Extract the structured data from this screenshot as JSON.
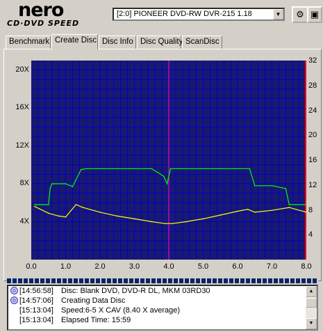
{
  "logo": {
    "brand": "nero",
    "product": "CD·DVD SPEED"
  },
  "drive": {
    "selected": "[2:0]  PIONEER DVD-RW  DVR-215 1.18"
  },
  "toolbar": {
    "icons": [
      "drive-settings-icon",
      "save-icon"
    ]
  },
  "tabs": [
    "Benchmark",
    "Create Disc",
    "Disc Info",
    "Disc Quality",
    "ScanDisc"
  ],
  "active_tab": "Create Disc",
  "colors": {
    "plot_bg": "#191970",
    "grid": "#0000c8",
    "write_speed": "#00ff00",
    "rpm": "#ffff00",
    "marker": "#ff00ff",
    "right_edge": "#ff0000"
  },
  "chart_data": {
    "type": "line",
    "x_ticks": [
      "0.0",
      "1.0",
      "2.0",
      "3.0",
      "4.0",
      "5.0",
      "6.0",
      "7.0",
      "8.0"
    ],
    "y_left_ticks": [
      "4X",
      "8X",
      "12X",
      "16X",
      "20X"
    ],
    "y_right_ticks": [
      "4",
      "8",
      "12",
      "16",
      "20",
      "24",
      "28",
      "32"
    ],
    "xlim": [
      0,
      8
    ],
    "ylim_left": [
      0,
      21
    ],
    "ylim_right": [
      0,
      32
    ],
    "layer_marker_x": 4.0,
    "series": [
      {
        "color": "#00ff00",
        "x": [
          0.1,
          0.5,
          0.55,
          0.6,
          1.0,
          1.2,
          1.45,
          1.6,
          2.0,
          2.5,
          3.0,
          3.5,
          3.85,
          3.95,
          4.05,
          4.3,
          5.0,
          5.5,
          6.0,
          6.35,
          6.5,
          7.0,
          7.4,
          7.5,
          8.0
        ],
        "y": [
          5.8,
          5.8,
          7.5,
          8.0,
          8.0,
          7.7,
          9.5,
          9.6,
          9.6,
          9.6,
          9.6,
          9.6,
          8.8,
          8.0,
          9.6,
          9.6,
          9.6,
          9.6,
          9.6,
          9.6,
          7.8,
          7.8,
          7.5,
          5.8,
          5.8
        ]
      },
      {
        "color": "#ffff00",
        "x": [
          0.1,
          0.5,
          0.8,
          1.0,
          1.3,
          1.5,
          2.0,
          2.5,
          3.0,
          3.5,
          3.9,
          4.1,
          4.5,
          5.0,
          5.5,
          6.0,
          6.3,
          6.5,
          7.0,
          7.5,
          8.0
        ],
        "y": [
          5.6,
          4.9,
          4.6,
          4.5,
          5.8,
          5.5,
          5.0,
          4.6,
          4.3,
          4.0,
          3.8,
          3.8,
          4.0,
          4.3,
          4.7,
          5.1,
          5.3,
          5.0,
          5.2,
          5.5,
          5.0
        ]
      }
    ]
  },
  "log": [
    {
      "time": "[14:56:58]",
      "msg": "Disc: Blank DVD, DVD-R DL, MKM 03RD30",
      "icon": "disc-icon"
    },
    {
      "time": "[14:57:06]",
      "msg": "Creating Data Disc",
      "icon": "disc-icon"
    },
    {
      "time": "[15:13:04]",
      "msg": "Speed:6-5 X CAV (8.40 X average)",
      "icon": ""
    },
    {
      "time": "[15:13:04]",
      "msg": "Elapsed Time: 15:59",
      "icon": ""
    }
  ]
}
